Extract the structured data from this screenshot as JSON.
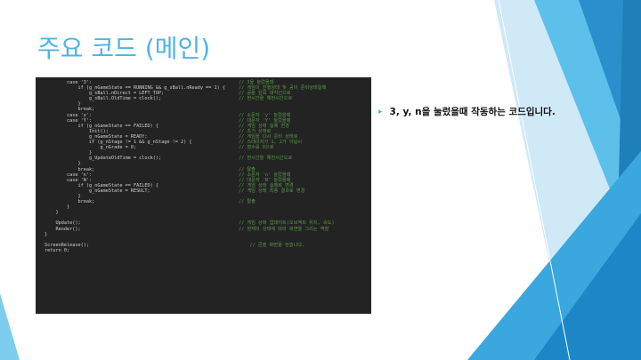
{
  "slide": {
    "title": "주요 코드 (메인)",
    "bullet": {
      "marker": "▸",
      "text": "3, y, n을 눌렀을때 작동하는 코드입니다."
    },
    "theme_colors": {
      "accent": "#4fb3e3",
      "accent_dark": "#1f7fb8",
      "code_bg": "#232323",
      "comment": "#5a9a4a"
    }
  },
  "code": {
    "lines": [
      {
        "text": "        case '3':",
        "comment": "// 3을 눌렀을때"
      },
      {
        "text": "            if (g_nGameState == RUNNING && g_sBall.nReady == 1) {",
        "comment": "// 게임이 진행상태 및 공이 준비상태일때"
      },
      {
        "text": "                g_sBall.nDirect = LEFT_TOP;",
        "comment": "// 공을 왼쪽 대각선으로"
      },
      {
        "text": "                g_sBall.OldTime = clock();",
        "comment": "// 현시간을 예전시간으로"
      },
      {
        "text": "            }",
        "comment": ""
      },
      {
        "text": "            break;",
        "comment": ""
      },
      {
        "text": "        case 'y':",
        "comment": "// 소문자 'y' 눌렀을때"
      },
      {
        "text": "        case 'Y':",
        "comment": "// 대문자 'Y' 눌렀을때"
      },
      {
        "text": "            if (g_nGameState == FAILED) {",
        "comment": "// 게임 상태 실패 변경"
      },
      {
        "text": "                Init();",
        "comment": "// 초기 상태로"
      },
      {
        "text": "                g_nGameState = READY;",
        "comment": "// 게임을 다시 준비 상태로"
      },
      {
        "text": "                if (g_nStage != 1 && g_nStage != 2) {",
        "comment": "// 스테이지가 1, 2가 아닐시"
      },
      {
        "text": "                    g_nGrade = 0;",
        "comment": "// 점수를 0으로"
      },
      {
        "text": "                }",
        "comment": ""
      },
      {
        "text": "                g_UpdateOldTime = clock();",
        "comment": "// 현시간을 예전시간으로"
      },
      {
        "text": "            }",
        "comment": ""
      },
      {
        "text": "            break;",
        "comment": "// 탈출"
      },
      {
        "text": "        case 'n':",
        "comment": "// 소문자 'n' 눌렀을때"
      },
      {
        "text": "        case 'N':",
        "comment": "// 대문자 'N' 눌렀을때"
      },
      {
        "text": "            if (g_nGameState == FAILED) {",
        "comment": "// 게임 상태 실패로 변경"
      },
      {
        "text": "                g_nGameState = RESULT;",
        "comment": "// 게임 상태 최종 결과로 변경"
      },
      {
        "text": "            }",
        "comment": ""
      },
      {
        "text": "            break;",
        "comment": "// 탈출"
      },
      {
        "text": "        }",
        "comment": ""
      },
      {
        "text": "    }",
        "comment": ""
      },
      {
        "text": "",
        "comment": ""
      },
      {
        "text": "    Update();",
        "comment": "// 게임 상태 업데이트(오브젝트 위치, 속도)"
      },
      {
        "text": "    Render();",
        "comment": "// 현재의 상태에 따라 화면을 그리는 역할"
      },
      {
        "text": "}",
        "comment": ""
      },
      {
        "text": "",
        "comment": ""
      },
      {
        "text": "ScreenRelease();",
        "comment": "    // 콘솔 화면을 닫습니다."
      },
      {
        "text": "return 0;",
        "comment": ""
      }
    ]
  }
}
